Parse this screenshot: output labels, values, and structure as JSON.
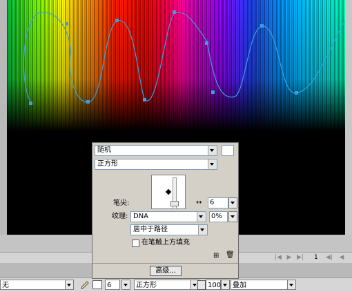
{
  "panel": {
    "brush_mode": "随机",
    "brush_shape": "正方形",
    "tip_label": "笔尖:",
    "arrow_label": "↔",
    "tip_size": "6",
    "texture_label": "纹理:",
    "texture_value": "DNA",
    "texture_percent": "0%",
    "placement": "居中于路径",
    "fill_over_checkbox_label": "在笔触上方填充",
    "fill_over_checked": false,
    "advanced_button": "高级..."
  },
  "page_nav": {
    "current_page": "1"
  },
  "toolbar": {
    "fill_value": "无",
    "stroke_size": "6",
    "stroke_shape": "正方形",
    "opacity": "100",
    "blend_mode": "叠加"
  },
  "canvas": {
    "description_colors": [
      "#00ff40",
      "#ffff00",
      "#ff8000",
      "#ff0000",
      "#ff00a0",
      "#8000ff",
      "#0040ff",
      "#00c0ff",
      "#00ffc0"
    ],
    "path_color": "#3aa0e0"
  }
}
